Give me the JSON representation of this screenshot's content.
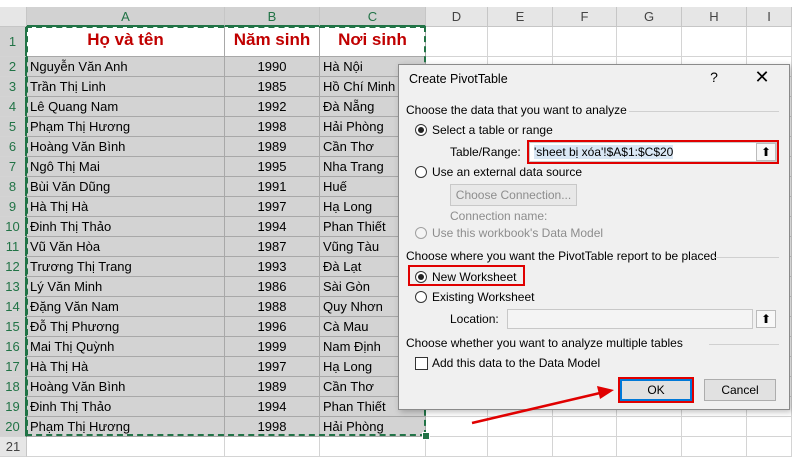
{
  "columns": [
    "A",
    "B",
    "C",
    "D",
    "E",
    "F",
    "G",
    "H",
    "I"
  ],
  "selected_columns": [
    "A",
    "B",
    "C"
  ],
  "rows": [
    1,
    2,
    3,
    4,
    5,
    6,
    7,
    8,
    9,
    10,
    11,
    12,
    13,
    14,
    15,
    16,
    17,
    18,
    19,
    20,
    21
  ],
  "table": {
    "headers": [
      "Họ và tên",
      "Năm sinh",
      "Nơi sinh"
    ],
    "records": [
      [
        "Nguyễn Văn Anh",
        "1990",
        "Hà Nội"
      ],
      [
        "Trần Thị Linh",
        "1985",
        "Hồ Chí Minh"
      ],
      [
        "Lê Quang Nam",
        "1992",
        "Đà Nẵng"
      ],
      [
        "Phạm Thị Hương",
        "1998",
        "Hải Phòng"
      ],
      [
        "Hoàng Văn Bình",
        "1989",
        "Cần Thơ"
      ],
      [
        "Ngô Thị Mai",
        "1995",
        "Nha Trang"
      ],
      [
        "Bùi Văn Dũng",
        "1991",
        "Huế"
      ],
      [
        "Hà Thị Hà",
        "1997",
        "Hạ Long"
      ],
      [
        "Đinh Thị Thảo",
        "1994",
        "Phan Thiết"
      ],
      [
        "Vũ Văn Hòa",
        "1987",
        "Vũng Tàu"
      ],
      [
        "Trương Thị Trang",
        "1993",
        "Đà Lạt"
      ],
      [
        "Lý Văn Minh",
        "1986",
        "Sài Gòn"
      ],
      [
        "Đặng Văn Nam",
        "1988",
        "Quy Nhơn"
      ],
      [
        "Đỗ Thị Phương",
        "1996",
        "Cà Mau"
      ],
      [
        "Mai Thị Quỳnh",
        "1999",
        "Nam Định"
      ],
      [
        "Hà Thị Hà",
        "1997",
        "Hạ Long"
      ],
      [
        "Hoàng Văn Bình",
        "1989",
        "Cần Thơ"
      ],
      [
        "Đinh Thị Thảo",
        "1994",
        "Phan Thiết"
      ],
      [
        "Phạm Thị Hương",
        "1998",
        "Hải Phòng"
      ]
    ]
  },
  "dialog": {
    "title": "Create PivotTable",
    "help_icon": "?",
    "close_icon": "✕",
    "section1": "Choose the data that you want to analyze",
    "opt_select_table": "Select a table or range",
    "table_range_label": "Table/Range:",
    "table_range_value": "'sheet bị xóa'!$A$1:$C$20",
    "opt_external": "Use an external data source",
    "choose_connection": "Choose Connection...",
    "connection_name": "Connection name:",
    "opt_data_model": "Use this workbook's Data Model",
    "section2": "Choose where you want the PivotTable report to be placed",
    "opt_new_ws": "New Worksheet",
    "opt_existing_ws": "Existing Worksheet",
    "location_label": "Location:",
    "location_value": "",
    "section3": "Choose whether you want to analyze multiple tables",
    "add_data_model": "Add this data to the Data Model",
    "ok": "OK",
    "cancel": "Cancel"
  },
  "colors": {
    "header_text": "#c00000",
    "selection_green": "#217346",
    "annotation_red": "#e00000",
    "default_button_blue": "#0078d7"
  }
}
